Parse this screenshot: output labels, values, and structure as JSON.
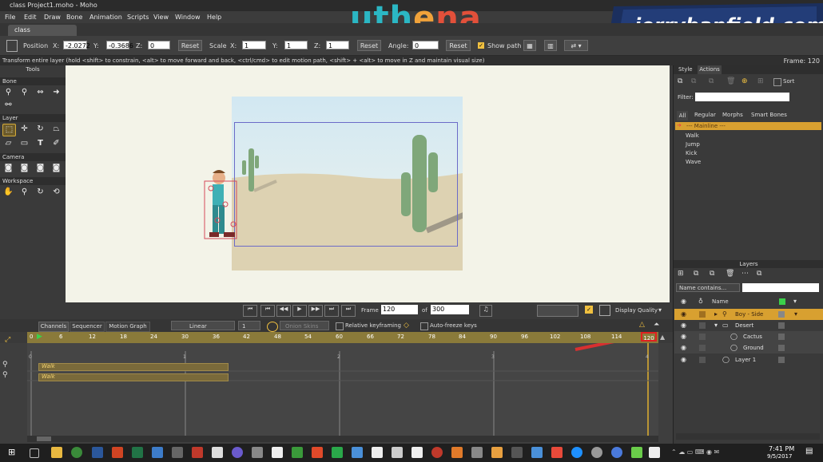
{
  "window": {
    "title": "class Project1.moho - Moho"
  },
  "watermarks": {
    "left": "uthena",
    "right": "jerrybanfield.com"
  },
  "menu": [
    "File",
    "Edit",
    "Draw",
    "Bone",
    "Animation",
    "Scripts",
    "View",
    "Window",
    "Help"
  ],
  "doc_tab": "class Project1.moho",
  "tool_options": {
    "position_label": "Position",
    "x_label": "X:",
    "x_value": "-2.0272",
    "y_label": "Y:",
    "y_value": "-0.3686",
    "z_label": "Z:",
    "z_value": "0",
    "reset1": "Reset",
    "scale_label": "Scale",
    "sx_label": "X:",
    "sx_value": "1",
    "sy_label": "Y:",
    "sy_value": "1",
    "sz_label": "Z:",
    "sz_value": "1",
    "reset2": "Reset",
    "angle_label": "Angle:",
    "angle_value": "0",
    "reset3": "Reset",
    "show_path": "Show path"
  },
  "status": {
    "text": "Transform entire layer (hold <shift> to constrain, <alt> to move forward and back, <ctrl/cmd> to edit motion path, <shift> + <alt> to move in Z and maintain visual size)",
    "frame": "Frame: 120"
  },
  "tools": {
    "title": "Tools",
    "sections": [
      "Bone",
      "Layer",
      "Camera",
      "Workspace"
    ]
  },
  "playback": {
    "frame_label": "Frame",
    "frame_value": "120",
    "of_label": "of",
    "total_frames": "300",
    "display_quality": "Display Quality"
  },
  "timeline": {
    "tabs": [
      "Channels",
      "Sequencer",
      "Motion Graph"
    ],
    "interpolation": "Linear",
    "interp_count": "1",
    "onion_skins": "Onion Skins",
    "relative_keyframing": "Relative keyframing",
    "auto_freeze": "Auto-freeze keys",
    "ticks": [
      "0",
      "6",
      "12",
      "18",
      "24",
      "30",
      "36",
      "42",
      "48",
      "54",
      "60",
      "66",
      "72",
      "78",
      "84",
      "90",
      "96",
      "102",
      "108",
      "114",
      "120"
    ],
    "sub_ticks": [
      "0",
      "1",
      "2",
      "3",
      "4"
    ],
    "tracks": [
      "Walk",
      "Walk"
    ]
  },
  "actions_panel": {
    "tabs": [
      "Style",
      "Actions"
    ],
    "sort": "Sort",
    "filter_label": "Filter:",
    "subtabs": [
      "All",
      "Regular",
      "Morphs",
      "Smart Bones"
    ],
    "items": [
      "--- Mainline ---",
      "Walk",
      "Jump",
      "Kick",
      "Wave"
    ]
  },
  "layers_panel": {
    "title": "Layers",
    "name_contains": "Name contains...",
    "col_name": "Name",
    "rows": [
      "Boy - Side",
      "Desert",
      "Cactus",
      "Ground",
      "Layer 1"
    ]
  },
  "taskbar": {
    "time": "7:41 PM",
    "date": "9/5/2017"
  }
}
